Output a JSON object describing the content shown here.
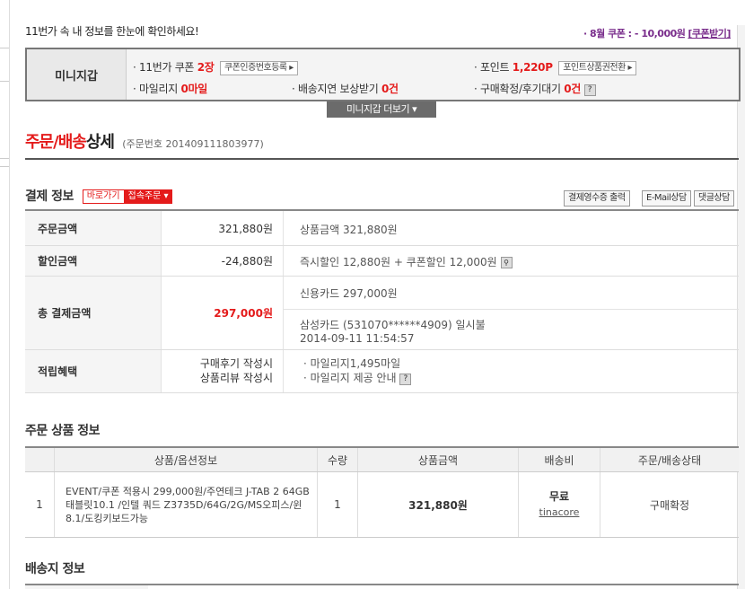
{
  "top": {
    "message": "11번가 속 내 정보를 한눈에 확인하세요!",
    "coupon_month": "· 8월 쿠폰 : ",
    "coupon_amount": "- 10,000원",
    "coupon_link": "[쿠폰받기]"
  },
  "wallet": {
    "title": "미니지갑",
    "coupon_label": "· 11번가 쿠폰",
    "coupon_value": "2장",
    "coupon_btn": "쿠폰인증번호등록 ▸",
    "point_label": "· 포인트",
    "point_value": "1,220P",
    "point_btn": "포인트상품권전환 ▸",
    "mileage_label": "· 마일리지",
    "mileage_value": "0마일",
    "delay_label": "· 배송지연 보상받기",
    "delay_value": "0건",
    "review_label": "· 구매확정/후기대기",
    "review_value": "0건",
    "qmark": "?",
    "more_btn": "미니지갑 더보기 ▾"
  },
  "page": {
    "title_red": "주문/배송",
    "title_black": "상세",
    "order_no": "(주문번호 201409111803977)"
  },
  "payment": {
    "section_title": "결제 정보",
    "shortcut_btn": "바로가기",
    "fold_btn": "접속주문 ▾",
    "receipt_btn": "결제영수증 출력",
    "email_btn": "E-Mail상담",
    "reply_btn": "댓글상담",
    "rows": {
      "order_amount": {
        "label": "주문금액",
        "value": "321,880원",
        "detail": "상품금액 321,880원"
      },
      "discount": {
        "label": "할인금액",
        "value": "-24,880원",
        "detail": "즉시할인 12,880원 + 쿠폰할인 12,000원"
      },
      "total": {
        "label": "총 결제금액",
        "value": "297,000원",
        "detail1": "신용카드 297,000원",
        "detail2": "삼성카드 (531070******4909) 일시불",
        "detail3": "2014-09-11 11:54:57"
      },
      "benefit": {
        "label": "적립혜택",
        "val1": "구매후기 작성시",
        "val2": "상품리뷰 작성시",
        "det1": "· 마일리지1,495마일",
        "det2": "· 마일리지 제공 안내"
      }
    }
  },
  "products": {
    "section_title": "주문 상품 정보",
    "headers": [
      "상품/옵션정보",
      "수량",
      "상품금액",
      "배송비",
      "주문/배송상태"
    ],
    "row": {
      "no": "1",
      "name": "EVENT/쿠폰 적용시 299,000원/주연테크 J-TAB 2 64GB 태블릿10.1 /인텔 쿼드 Z3735D/64G/2G/MS오피스/윈8.1/도킹키보드가능",
      "qty": "1",
      "price": "321,880원",
      "shipping": "무료",
      "seller": "tinacore",
      "status": "구매확정"
    }
  },
  "delivery": {
    "section_title": "배송지 정보"
  }
}
